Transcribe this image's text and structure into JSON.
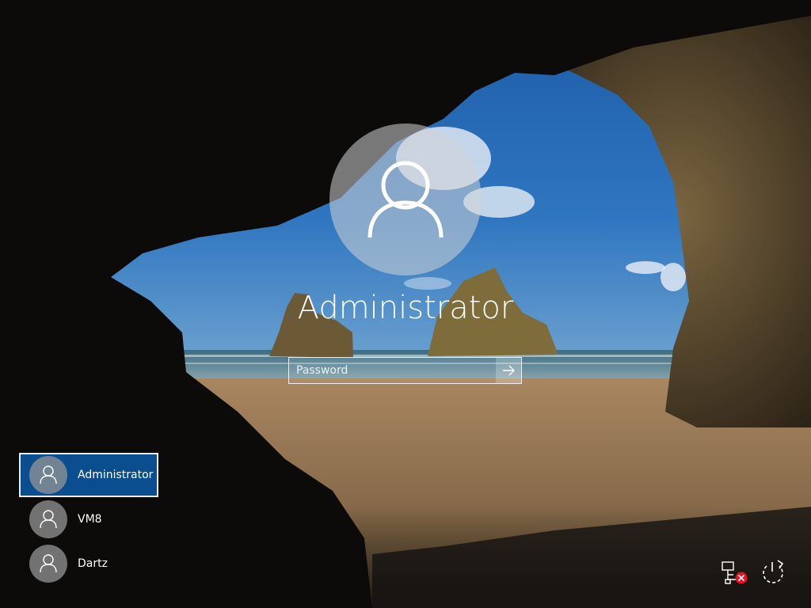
{
  "login": {
    "username": "Administrator",
    "password_placeholder": "Password",
    "big_avatar_icon": "user-icon",
    "submit_icon": "arrow-right-icon"
  },
  "users": [
    {
      "name": "Administrator",
      "selected": true,
      "icon": "user-icon"
    },
    {
      "name": "VM8",
      "selected": false,
      "icon": "user-icon"
    },
    {
      "name": "Dartz",
      "selected": false,
      "icon": "user-icon"
    }
  ],
  "system_icons": {
    "network": "network-disconnected-icon",
    "power": "power-icon"
  },
  "colors": {
    "selected_user_bg": "#0b4e8f",
    "sky": "#1f5fa8",
    "sand": "#9b7a52",
    "rock": "#3a2f22",
    "error_badge": "#e81123"
  }
}
